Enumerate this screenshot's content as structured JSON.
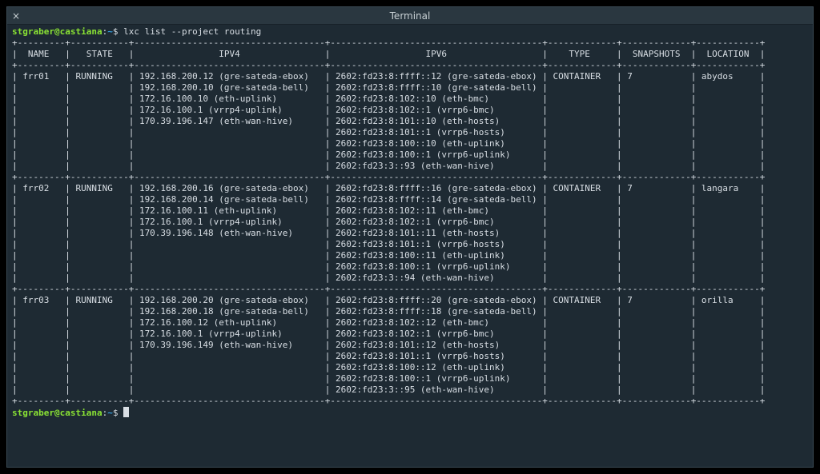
{
  "window": {
    "title": "Terminal",
    "close_glyph": "×"
  },
  "prompt": {
    "userhost": "stgraber@castiana",
    "sep": ":",
    "cwd": "~",
    "sigil": "$ "
  },
  "command": "lxc list --project routing",
  "table": {
    "headers": [
      "NAME",
      "STATE",
      "IPV4",
      "IPV6",
      "TYPE",
      "SNAPSHOTS",
      "LOCATION"
    ],
    "rows": [
      {
        "name": "frr01",
        "state": "RUNNING",
        "ipv4": [
          "192.168.200.12 (gre-sateda-ebox)",
          "192.168.200.10 (gre-sateda-bell)",
          "172.16.100.10 (eth-uplink)",
          "172.16.100.1 (vrrp4-uplink)",
          "170.39.196.147 (eth-wan-hive)"
        ],
        "ipv6": [
          "2602:fd23:8:ffff::12 (gre-sateda-ebox)",
          "2602:fd23:8:ffff::10 (gre-sateda-bell)",
          "2602:fd23:8:102::10 (eth-bmc)",
          "2602:fd23:8:102::1 (vrrp6-bmc)",
          "2602:fd23:8:101::10 (eth-hosts)",
          "2602:fd23:8:101::1 (vrrp6-hosts)",
          "2602:fd23:8:100::10 (eth-uplink)",
          "2602:fd23:8:100::1 (vrrp6-uplink)",
          "2602:fd23:3::93 (eth-wan-hive)"
        ],
        "type": "CONTAINER",
        "snapshots": "7",
        "location": "abydos"
      },
      {
        "name": "frr02",
        "state": "RUNNING",
        "ipv4": [
          "192.168.200.16 (gre-sateda-ebox)",
          "192.168.200.14 (gre-sateda-bell)",
          "172.16.100.11 (eth-uplink)",
          "172.16.100.1 (vrrp4-uplink)",
          "170.39.196.148 (eth-wan-hive)"
        ],
        "ipv6": [
          "2602:fd23:8:ffff::16 (gre-sateda-ebox)",
          "2602:fd23:8:ffff::14 (gre-sateda-bell)",
          "2602:fd23:8:102::11 (eth-bmc)",
          "2602:fd23:8:102::1 (vrrp6-bmc)",
          "2602:fd23:8:101::11 (eth-hosts)",
          "2602:fd23:8:101::1 (vrrp6-hosts)",
          "2602:fd23:8:100::11 (eth-uplink)",
          "2602:fd23:8:100::1 (vrrp6-uplink)",
          "2602:fd23:3::94 (eth-wan-hive)"
        ],
        "type": "CONTAINER",
        "snapshots": "7",
        "location": "langara"
      },
      {
        "name": "frr03",
        "state": "RUNNING",
        "ipv4": [
          "192.168.200.20 (gre-sateda-ebox)",
          "192.168.200.18 (gre-sateda-bell)",
          "172.16.100.12 (eth-uplink)",
          "172.16.100.1 (vrrp4-uplink)",
          "170.39.196.149 (eth-wan-hive)"
        ],
        "ipv6": [
          "2602:fd23:8:ffff::20 (gre-sateda-ebox)",
          "2602:fd23:8:ffff::18 (gre-sateda-bell)",
          "2602:fd23:8:102::12 (eth-bmc)",
          "2602:fd23:8:102::1 (vrrp6-bmc)",
          "2602:fd23:8:101::12 (eth-hosts)",
          "2602:fd23:8:101::1 (vrrp6-hosts)",
          "2602:fd23:8:100::12 (eth-uplink)",
          "2602:fd23:8:100::1 (vrrp6-uplink)",
          "2602:fd23:3::95 (eth-wan-hive)"
        ],
        "type": "CONTAINER",
        "snapshots": "7",
        "location": "orilla"
      }
    ]
  },
  "cols": {
    "name": 7,
    "state": 9,
    "ipv4": 34,
    "ipv6": 38,
    "type": 11,
    "snapshots": 11,
    "location": 10
  }
}
